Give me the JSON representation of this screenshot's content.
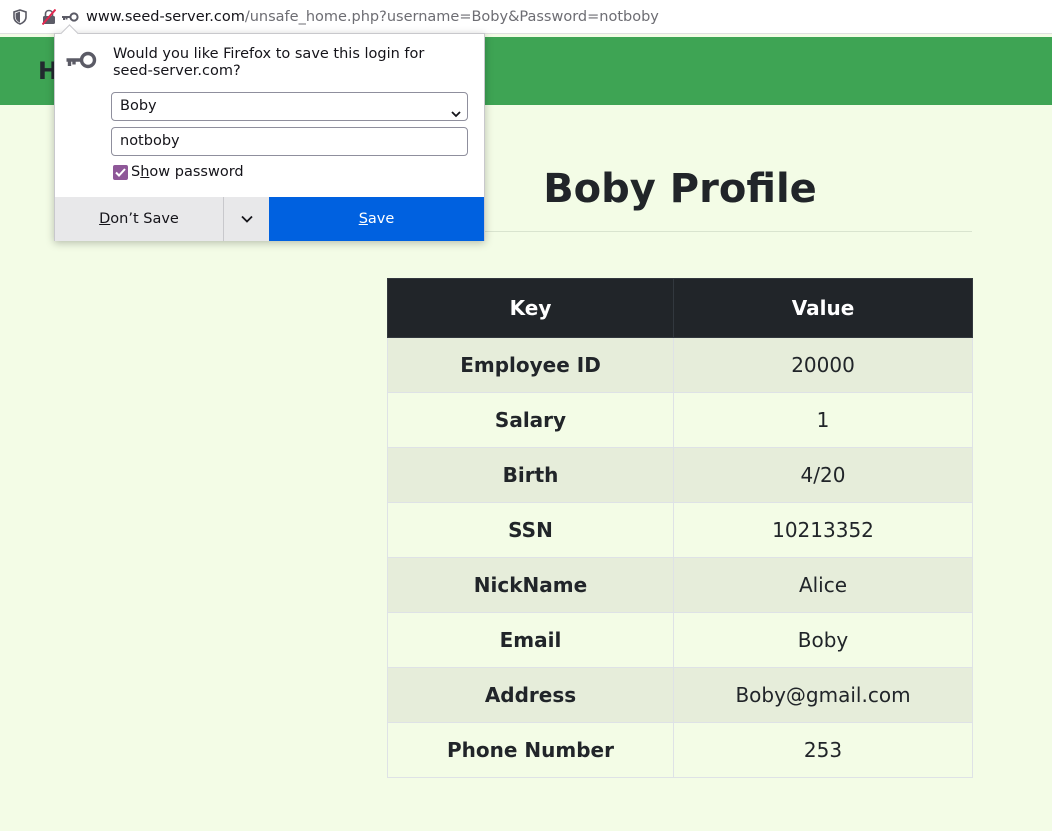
{
  "browser": {
    "url_host": "www.seed-server.com",
    "url_path": "/unsafe_home.php?username=Boby&Password=notboby",
    "icons": [
      "shield-icon",
      "lock-insecure-icon",
      "key-icon"
    ]
  },
  "nav": {
    "brand_initial": "H"
  },
  "popup": {
    "message": "Would you like Firefox to save this login for seed-server.com?",
    "username_value": "Boby",
    "password_value": "notboby",
    "show_password_label_pre": "S",
    "show_password_label_accel": "h",
    "show_password_label_post": "ow password",
    "show_password_checked": true,
    "dont_save_accel": "D",
    "dont_save_rest": "on’t Save",
    "save_accel": "S",
    "save_rest": "ave",
    "accent": "#0061e0",
    "checkbox_color": "#8e5798"
  },
  "page": {
    "title": "Boby Profile",
    "header_color": "#3ea454",
    "background": "#f3fce6"
  },
  "table": {
    "headers": [
      "Key",
      "Value"
    ],
    "rows": [
      [
        "Employee ID",
        "20000"
      ],
      [
        "Salary",
        "1"
      ],
      [
        "Birth",
        "4/20"
      ],
      [
        "SSN",
        "10213352"
      ],
      [
        "NickName",
        "Alice"
      ],
      [
        "Email",
        "Boby"
      ],
      [
        "Address",
        "Boby@gmail.com"
      ],
      [
        "Phone Number",
        "253"
      ]
    ]
  }
}
